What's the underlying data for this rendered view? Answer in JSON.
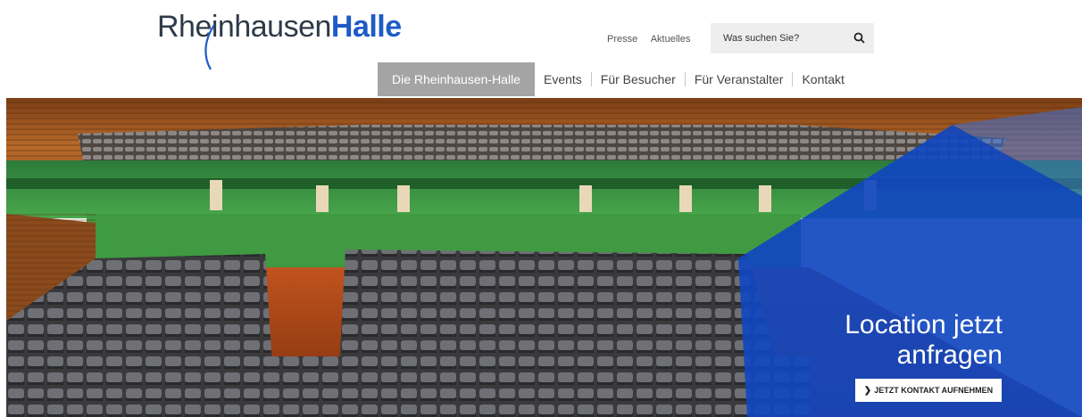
{
  "logo": {
    "part1": "Rheinhausen",
    "part2": "Halle"
  },
  "top_links": [
    {
      "label": "Presse"
    },
    {
      "label": "Aktuelles"
    }
  ],
  "search": {
    "placeholder": "Was suchen Sie?",
    "icon": "search-icon"
  },
  "nav": [
    {
      "label": "Die Rheinhausen-Halle",
      "active": true
    },
    {
      "label": "Events"
    },
    {
      "label": "Für Besucher"
    },
    {
      "label": "Für Veranstalter"
    },
    {
      "label": "Kontakt"
    }
  ],
  "hero": {
    "cta_line1": "Location jetzt",
    "cta_line2": "anfragen",
    "cta_button": "JETZT KONTAKT AUFNEHMEN",
    "cta_arrow_icon": "chevron-right-icon"
  },
  "colors": {
    "brand_blue": "#1e5bc6",
    "logo_dark": "#2e3a48",
    "nav_active_bg": "#a4a4a4",
    "cta_overlay": "#1046c0",
    "search_bg": "#eeeeee"
  }
}
